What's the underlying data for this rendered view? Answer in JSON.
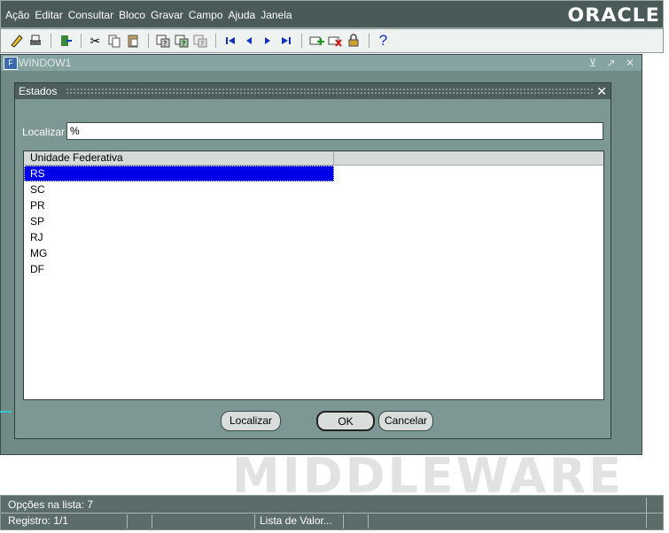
{
  "menu": [
    "Ação",
    "Editar",
    "Consultar",
    "Bloco",
    "Gravar",
    "Campo",
    "Ajuda",
    "Janela"
  ],
  "brand": "ORACLE",
  "toolbar": {
    "icons": [
      "save-icon",
      "print-icon",
      "exit-icon",
      "cut-icon",
      "copy-icon",
      "paste-icon",
      "enter-query-icon",
      "execute-query-icon",
      "cancel-query-icon",
      "first-record-icon",
      "previous-record-icon",
      "next-record-icon",
      "last-record-icon",
      "insert-record-icon",
      "delete-record-icon",
      "lock-record-icon",
      "help-icon"
    ]
  },
  "window": {
    "title": "WINDOW1",
    "controls": "⊻ ↗ ✕"
  },
  "dialog": {
    "title": "Estados",
    "find_label": "Localizar",
    "find_value": "%",
    "column_header": "Unidade Federativa",
    "rows": [
      "RS",
      "SC",
      "PR",
      "SP",
      "RJ",
      "MG",
      "DF"
    ],
    "selected_index": 0,
    "buttons": {
      "find": "Localizar",
      "ok": "OK",
      "cancel": "Cancelar"
    }
  },
  "watermark": "MIDDLEWARE",
  "status": {
    "options": "Opções na lista: 7",
    "record": "Registro: 1/1",
    "mode": "Lista de Valor..."
  },
  "colors": {
    "selection": "#0000e8",
    "window_bg": "#6f8a87",
    "titlebar": "#4d5f5d"
  }
}
